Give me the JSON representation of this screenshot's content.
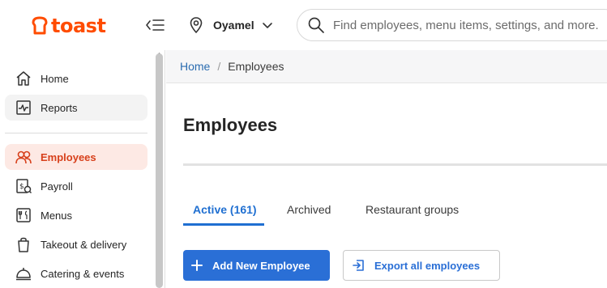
{
  "brand": {
    "name": "toast",
    "color": "#ff4c00"
  },
  "header": {
    "location_name": "Oyamel",
    "search_placeholder": "Find employees, menu items, settings, and more."
  },
  "sidebar": {
    "items": [
      {
        "label": "Home",
        "icon": "home-icon",
        "state": "default"
      },
      {
        "label": "Reports",
        "icon": "reports-icon",
        "state": "hover"
      },
      {
        "label": "Employees",
        "icon": "employees-icon",
        "state": "active"
      },
      {
        "label": "Payroll",
        "icon": "payroll-icon",
        "state": "default"
      },
      {
        "label": "Menus",
        "icon": "menus-icon",
        "state": "default"
      },
      {
        "label": "Takeout & delivery",
        "icon": "takeout-icon",
        "state": "default"
      },
      {
        "label": "Catering & events",
        "icon": "catering-icon",
        "state": "default"
      }
    ]
  },
  "breadcrumb": {
    "home": "Home",
    "separator": "/",
    "current": "Employees"
  },
  "page": {
    "title": "Employees"
  },
  "tabs": [
    {
      "label": "Active (161)",
      "active": true
    },
    {
      "label": "Archived",
      "active": false
    },
    {
      "label": "Restaurant groups",
      "active": false
    }
  ],
  "actions": {
    "add_label": "Add New Employee",
    "export_label": "Export all employees"
  },
  "colors": {
    "accent_blue": "#2a6fd6",
    "active_nav_bg": "#fde9e4",
    "active_nav_text": "#d7401b"
  }
}
